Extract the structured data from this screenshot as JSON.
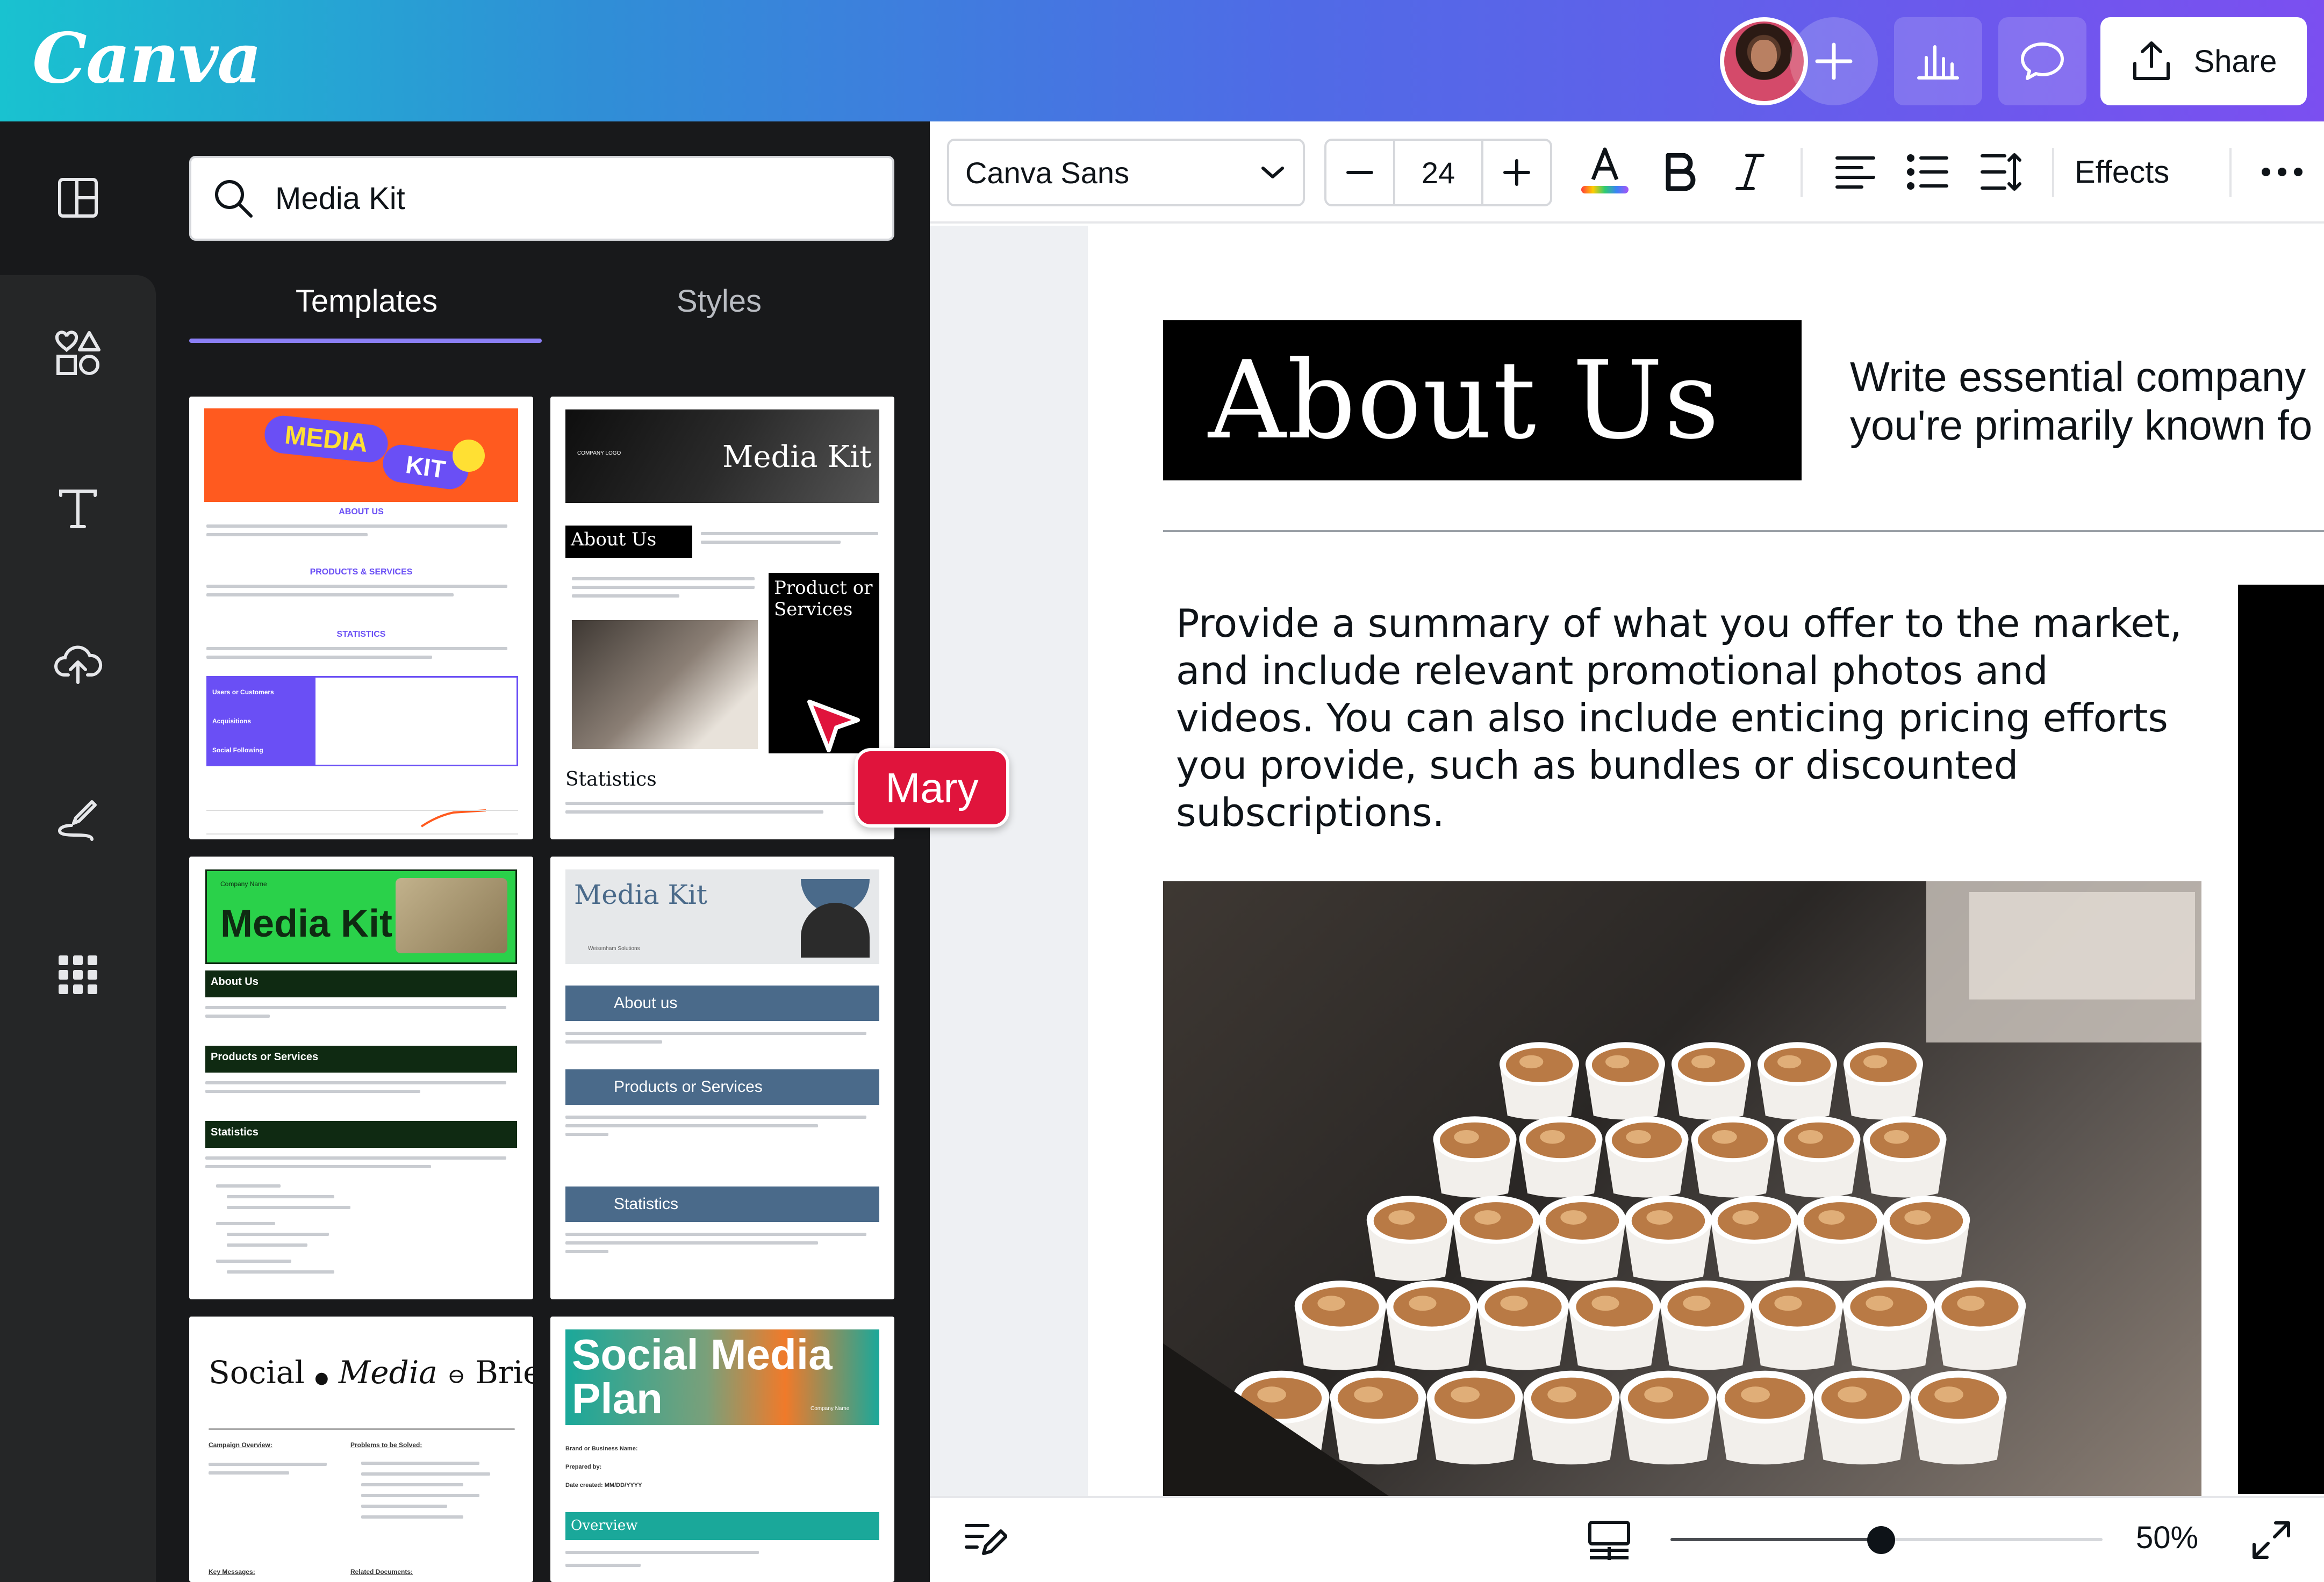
{
  "app": {
    "logo": "Canva",
    "share_label": "Share",
    "colors": {
      "gradient_start": "#19c2d0",
      "gradient_end": "#7b4ff0",
      "collab_label": "#e0143c",
      "tab_underline": "#8b7ff6"
    }
  },
  "header": {
    "icons": [
      "avatar",
      "plus-icon",
      "insights-icon",
      "comment-icon",
      "share-icon"
    ]
  },
  "rail": {
    "icons": [
      "layout-icon",
      "elements-icon",
      "text-icon",
      "upload-icon",
      "draw-icon",
      "apps-icon"
    ]
  },
  "panel": {
    "search_value": "Media Kit",
    "tabs": [
      {
        "label": "Templates",
        "active": true
      },
      {
        "label": "Styles",
        "active": false
      }
    ],
    "templates": [
      {
        "title_word1": "MEDIA",
        "title_word2": "KIT",
        "sections": [
          "ABOUT US",
          "PRODUCTS & SERVICES",
          "STATISTICS"
        ],
        "rows": [
          "Users or Customers",
          "Acquisitions",
          "Social Following"
        ]
      },
      {
        "title": "Media Kit",
        "logo_text": "COMPANY LOGO",
        "about": "About Us",
        "products": "Product or Services",
        "stats": "Statistics"
      },
      {
        "company": "Company Name",
        "title": "Media Kit",
        "sections": [
          "About Us",
          "Products or Services",
          "Statistics"
        ]
      },
      {
        "title": "Media Kit",
        "company": "Weisenham Solutions",
        "sections": [
          "About us",
          "Products or Services",
          "Statistics"
        ]
      },
      {
        "title_a": "Social",
        "title_b": "Media",
        "title_c": "Brief",
        "col1": "Campaign Overview:",
        "col2": "Problems to be Solved:",
        "col3": "Key Messages:",
        "col4": "Related Documents:"
      },
      {
        "title_a": "Social Media",
        "title_b": "Plan",
        "company": "Company Name",
        "overview": "Overview",
        "fields": [
          "Brand or Business Name:",
          "Prepared by:",
          "Date created: MM/DD/YYYY"
        ]
      }
    ]
  },
  "toolbar": {
    "font": "Canva Sans",
    "size": "24",
    "effects_label": "Effects"
  },
  "canvas": {
    "about_title": "About Us",
    "about_desc_line1": "Write essential company",
    "about_desc_line2": "you're primarily known fo",
    "summary": "Provide a summary of what you offer to the market, and include relevant promotional photos and videos. You can also include enticing pricing efforts you provide, such as bundles or discounted subscriptions."
  },
  "collaborator": {
    "name": "Mary"
  },
  "bottom": {
    "zoom": "50%",
    "zoom_fraction": 0.45
  }
}
